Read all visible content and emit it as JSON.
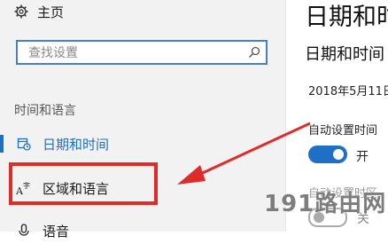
{
  "sidebar": {
    "home_label": "主页",
    "search_placeholder": "查找设置",
    "section_title": "时间和语言",
    "items": [
      {
        "label": "日期和时间",
        "icon": "calendar-clock-icon",
        "active": true
      },
      {
        "label": "区域和语言",
        "icon": "language-icon",
        "active": false
      },
      {
        "label": "语音",
        "icon": "microphone-icon",
        "active": false
      }
    ]
  },
  "main": {
    "title": "日期和时",
    "subtitle": "日期和时间",
    "current_date": "2018年5月11日",
    "auto_time_label": "自动设置时间",
    "auto_time_state": "开",
    "auto_tz_label": "自动设置时区",
    "auto_tz_state": "关"
  },
  "watermark": "191路由网",
  "colors": {
    "accent": "#1f6fc4",
    "highlight": "#e02b2b"
  }
}
